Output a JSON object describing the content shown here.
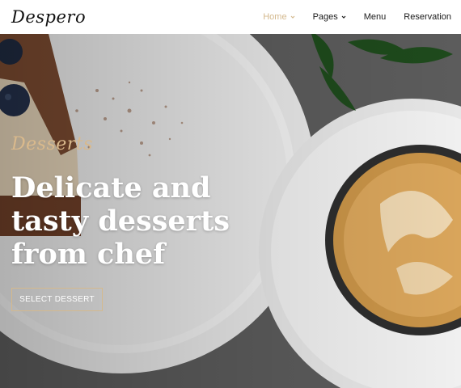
{
  "header": {
    "logo_text": "Despero",
    "nav": [
      {
        "label": "Home",
        "has_dropdown": true,
        "active": true
      },
      {
        "label": "Pages",
        "has_dropdown": true,
        "active": false
      },
      {
        "label": "Menu",
        "has_dropdown": false,
        "active": false
      },
      {
        "label": "Reservation",
        "has_dropdown": false,
        "active": false
      }
    ]
  },
  "hero": {
    "subtitle": "Desserts",
    "headline": "Delicate and tasty desserts from chef",
    "cta_label": "SELECT DESSERT"
  },
  "colors": {
    "accent": "#d4b98e",
    "nav_text": "#1a1a1a",
    "background": "#ffffff"
  }
}
